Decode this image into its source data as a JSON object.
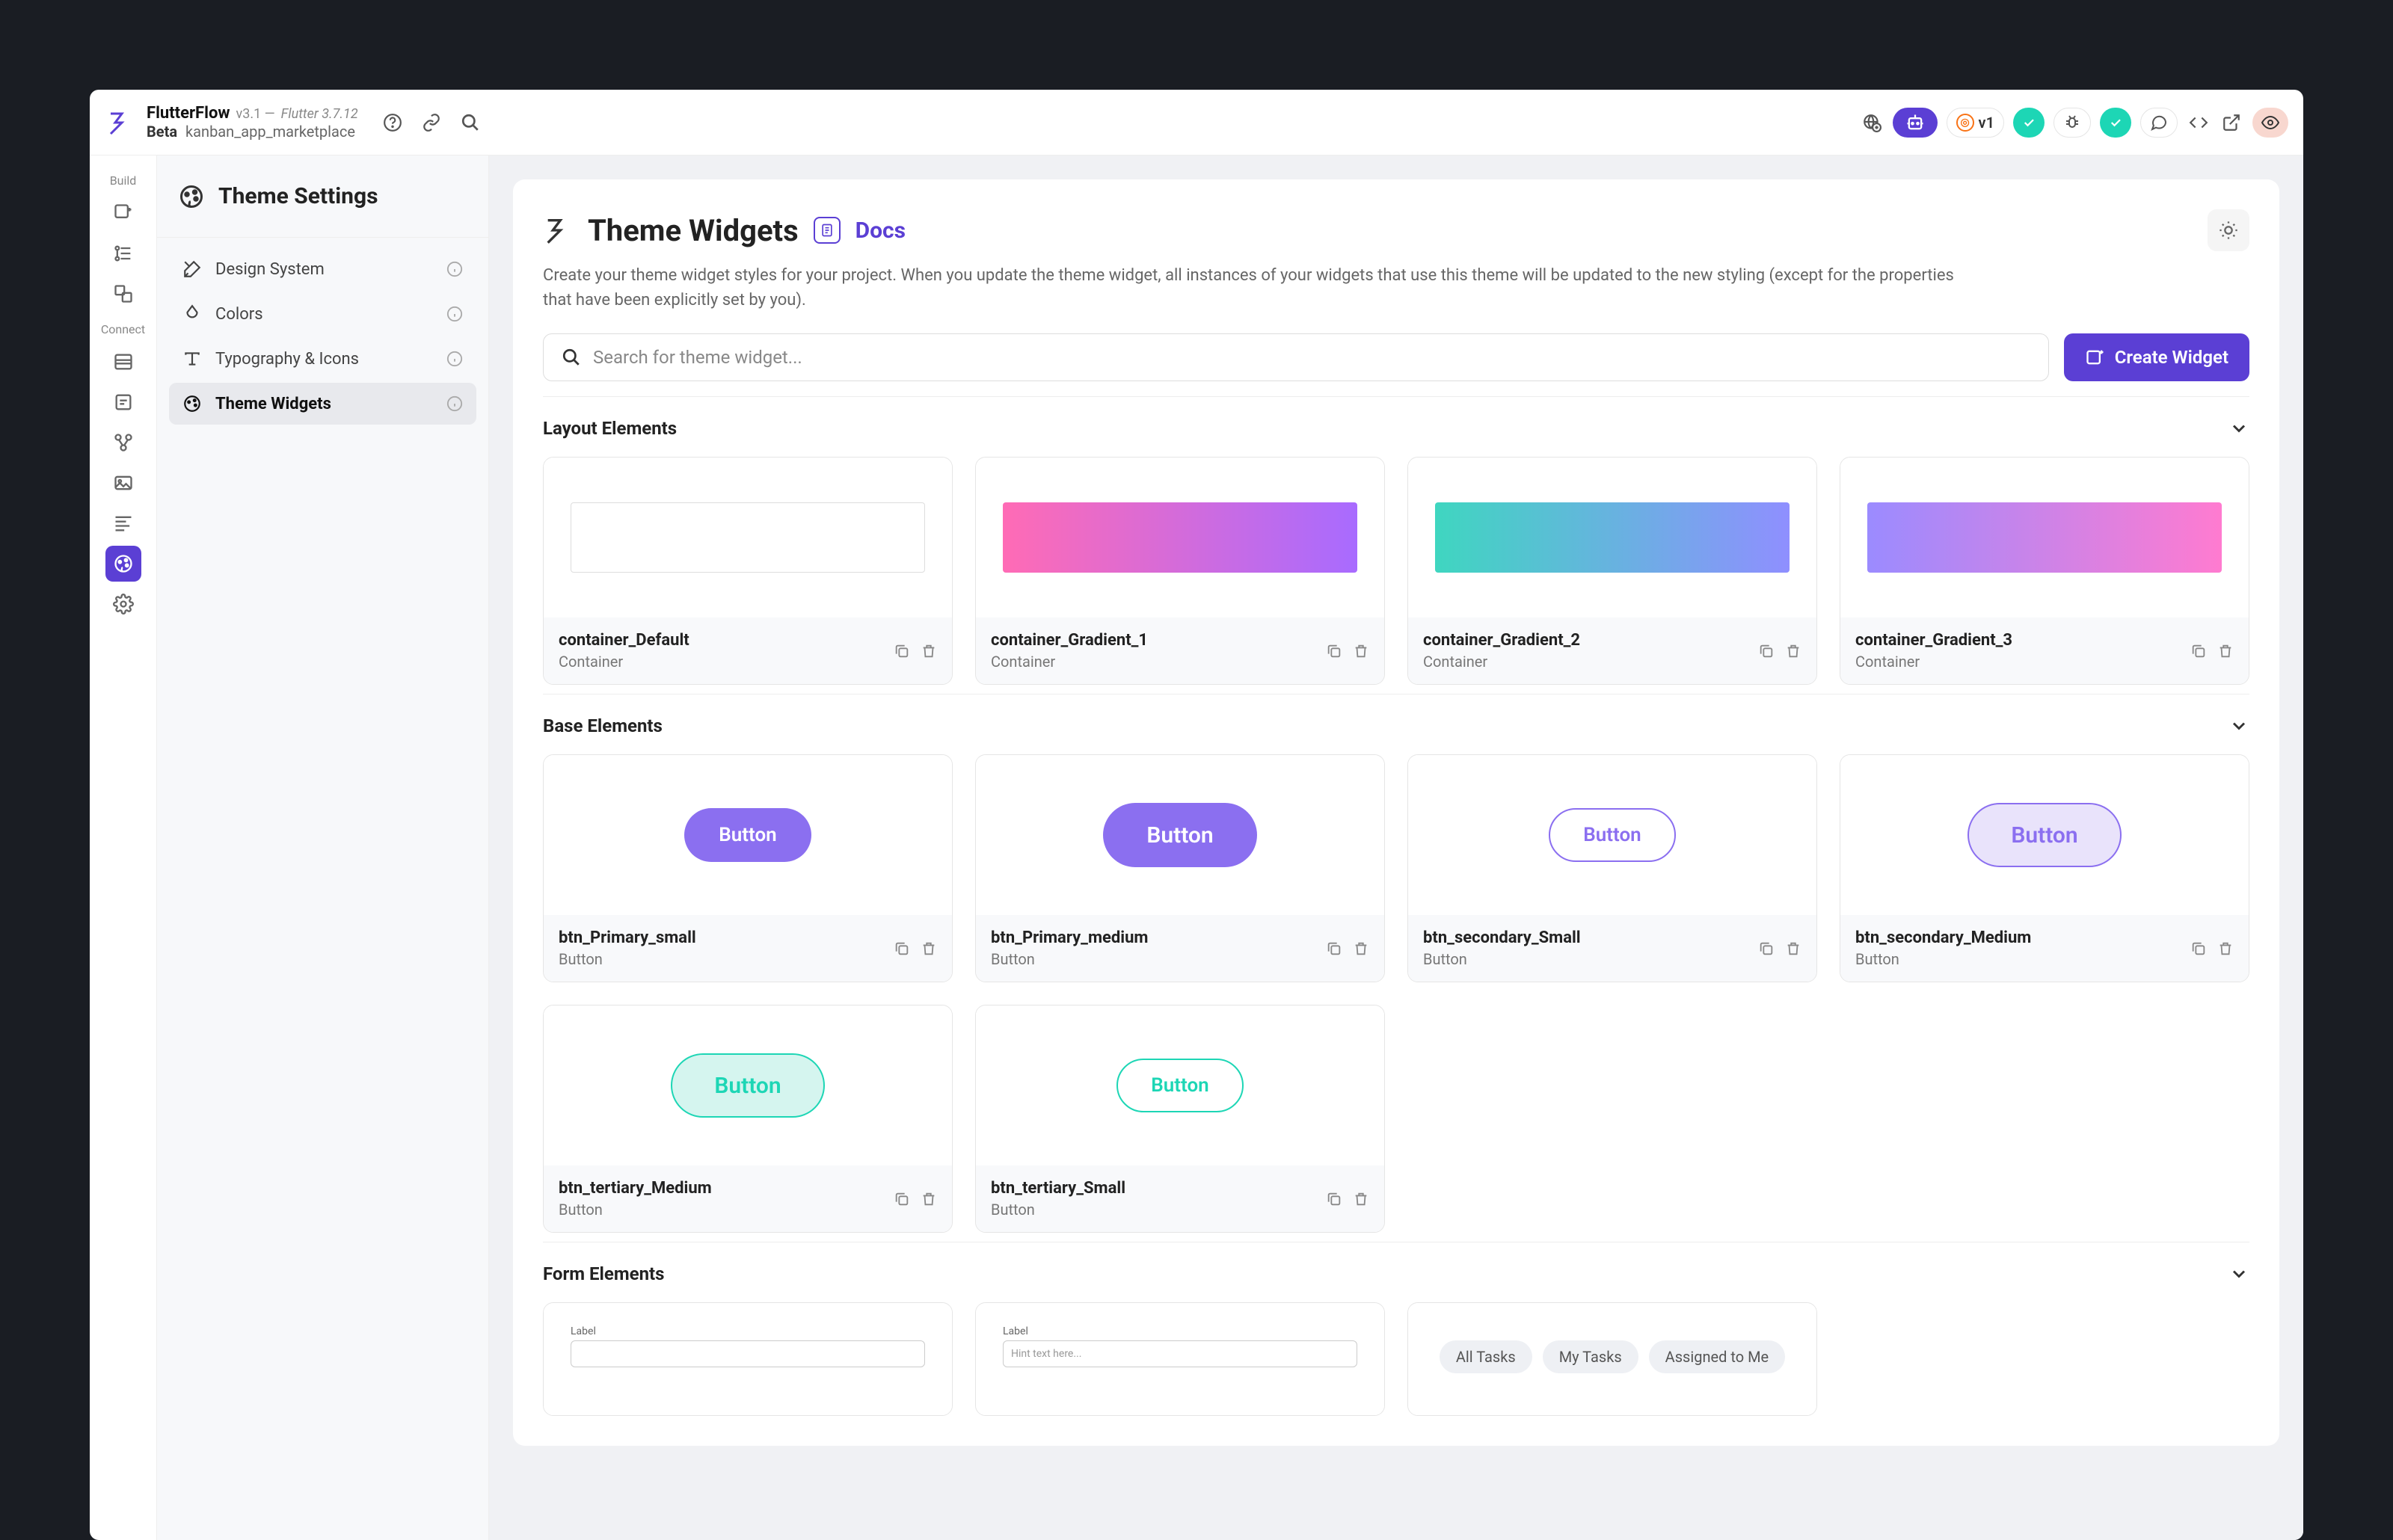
{
  "header": {
    "product": "FlutterFlow",
    "version": "v3.1 —",
    "flutter": "Flutter 3.7.12",
    "beta": "Beta",
    "project": "kanban_app_marketplace",
    "v_label": "v1"
  },
  "sidebar": {
    "title": "Theme Settings",
    "items": [
      {
        "label": "Design System"
      },
      {
        "label": "Colors"
      },
      {
        "label": "Typography & Icons"
      },
      {
        "label": "Theme Widgets"
      }
    ]
  },
  "rail": {
    "build": "Build",
    "connect": "Connect"
  },
  "page": {
    "title": "Theme Widgets",
    "docs": "Docs",
    "description": "Create your theme widget styles for your project. When you update the theme widget, all instances of your widgets that use this theme will be updated to the new styling (except for the properties that have been explicitly set by you).",
    "search_placeholder": "Search for theme widget...",
    "create_label": "Create Widget"
  },
  "sections": [
    {
      "title": "Layout Elements",
      "widgets": [
        {
          "name": "container_Default",
          "type": "Container"
        },
        {
          "name": "container_Gradient_1",
          "type": "Container"
        },
        {
          "name": "container_Gradient_2",
          "type": "Container"
        },
        {
          "name": "container_Gradient_3",
          "type": "Container"
        }
      ]
    },
    {
      "title": "Base Elements",
      "widgets": [
        {
          "name": "btn_Primary_small",
          "type": "Button",
          "preview": "Button"
        },
        {
          "name": "btn_Primary_medium",
          "type": "Button",
          "preview": "Button"
        },
        {
          "name": "btn_secondary_Small",
          "type": "Button",
          "preview": "Button"
        },
        {
          "name": "btn_secondary_Medium",
          "type": "Button",
          "preview": "Button"
        },
        {
          "name": "btn_tertiary_Medium",
          "type": "Button",
          "preview": "Button"
        },
        {
          "name": "btn_tertiary_Small",
          "type": "Button",
          "preview": "Button"
        }
      ]
    },
    {
      "title": "Form Elements",
      "form_labels": {
        "label": "Label",
        "hint": "Hint text here..."
      },
      "chips": [
        "All Tasks",
        "My Tasks",
        "Assigned to Me"
      ]
    }
  ]
}
